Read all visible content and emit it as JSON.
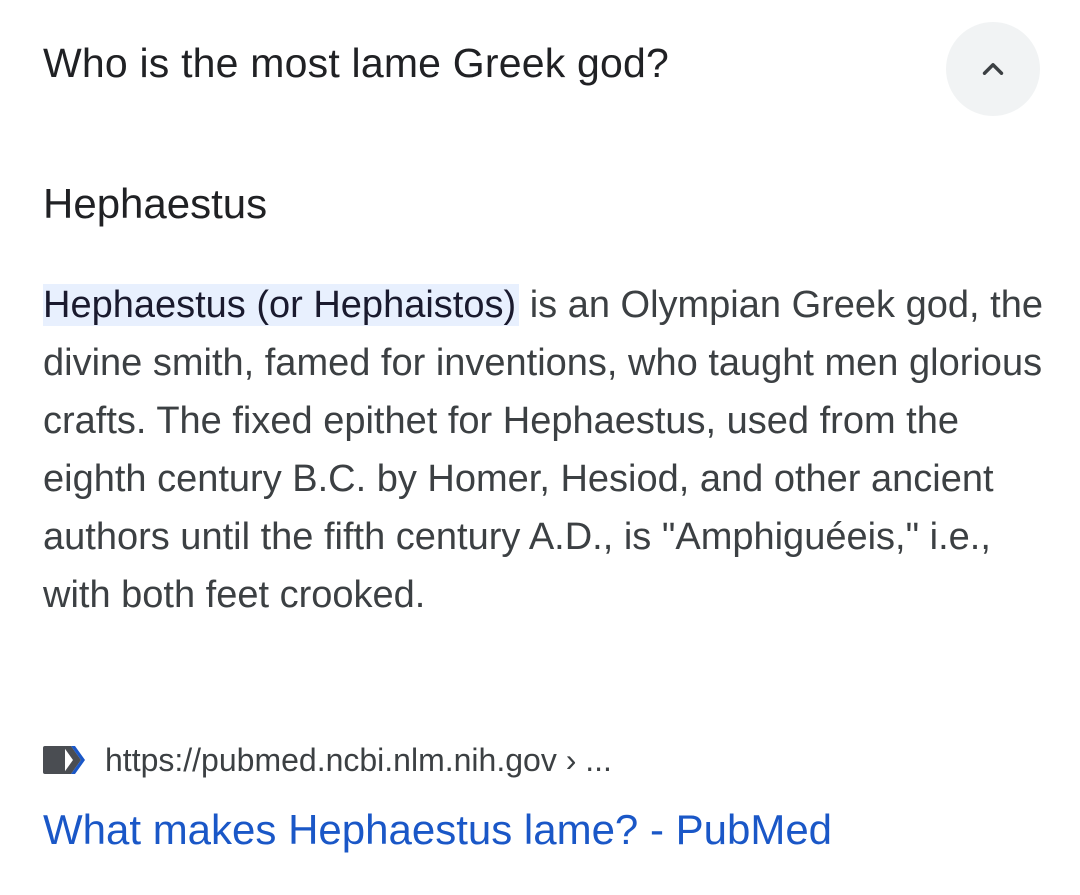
{
  "question": {
    "text": "Who is the most lame Greek god?",
    "toggle_icon": "chevron-up-icon"
  },
  "answer": {
    "title": "Hephaestus",
    "highlight": "Hephaestus (or Hephaistos)",
    "body": " is an Olympian Greek god, the divine smith, famed for inventions, who taught men glorious crafts. The fixed epithet for Hephaestus, used from the eighth century B.C. by Homer, Hesiod, and other ancient authors until the fifth century A.D., is \"Amphiguéeis,\" i.e., with both feet crooked."
  },
  "source": {
    "icon": "site-favicon-icon",
    "url": "https://pubmed.ncbi.nlm.nih.gov › ...",
    "link_title": "What makes Hephaestus lame? - PubMed"
  },
  "colors": {
    "text": "#202124",
    "body_text": "#3c4043",
    "highlight_bg": "#e8f0fe",
    "link": "#1a57c7",
    "button_bg": "#f1f3f4"
  }
}
